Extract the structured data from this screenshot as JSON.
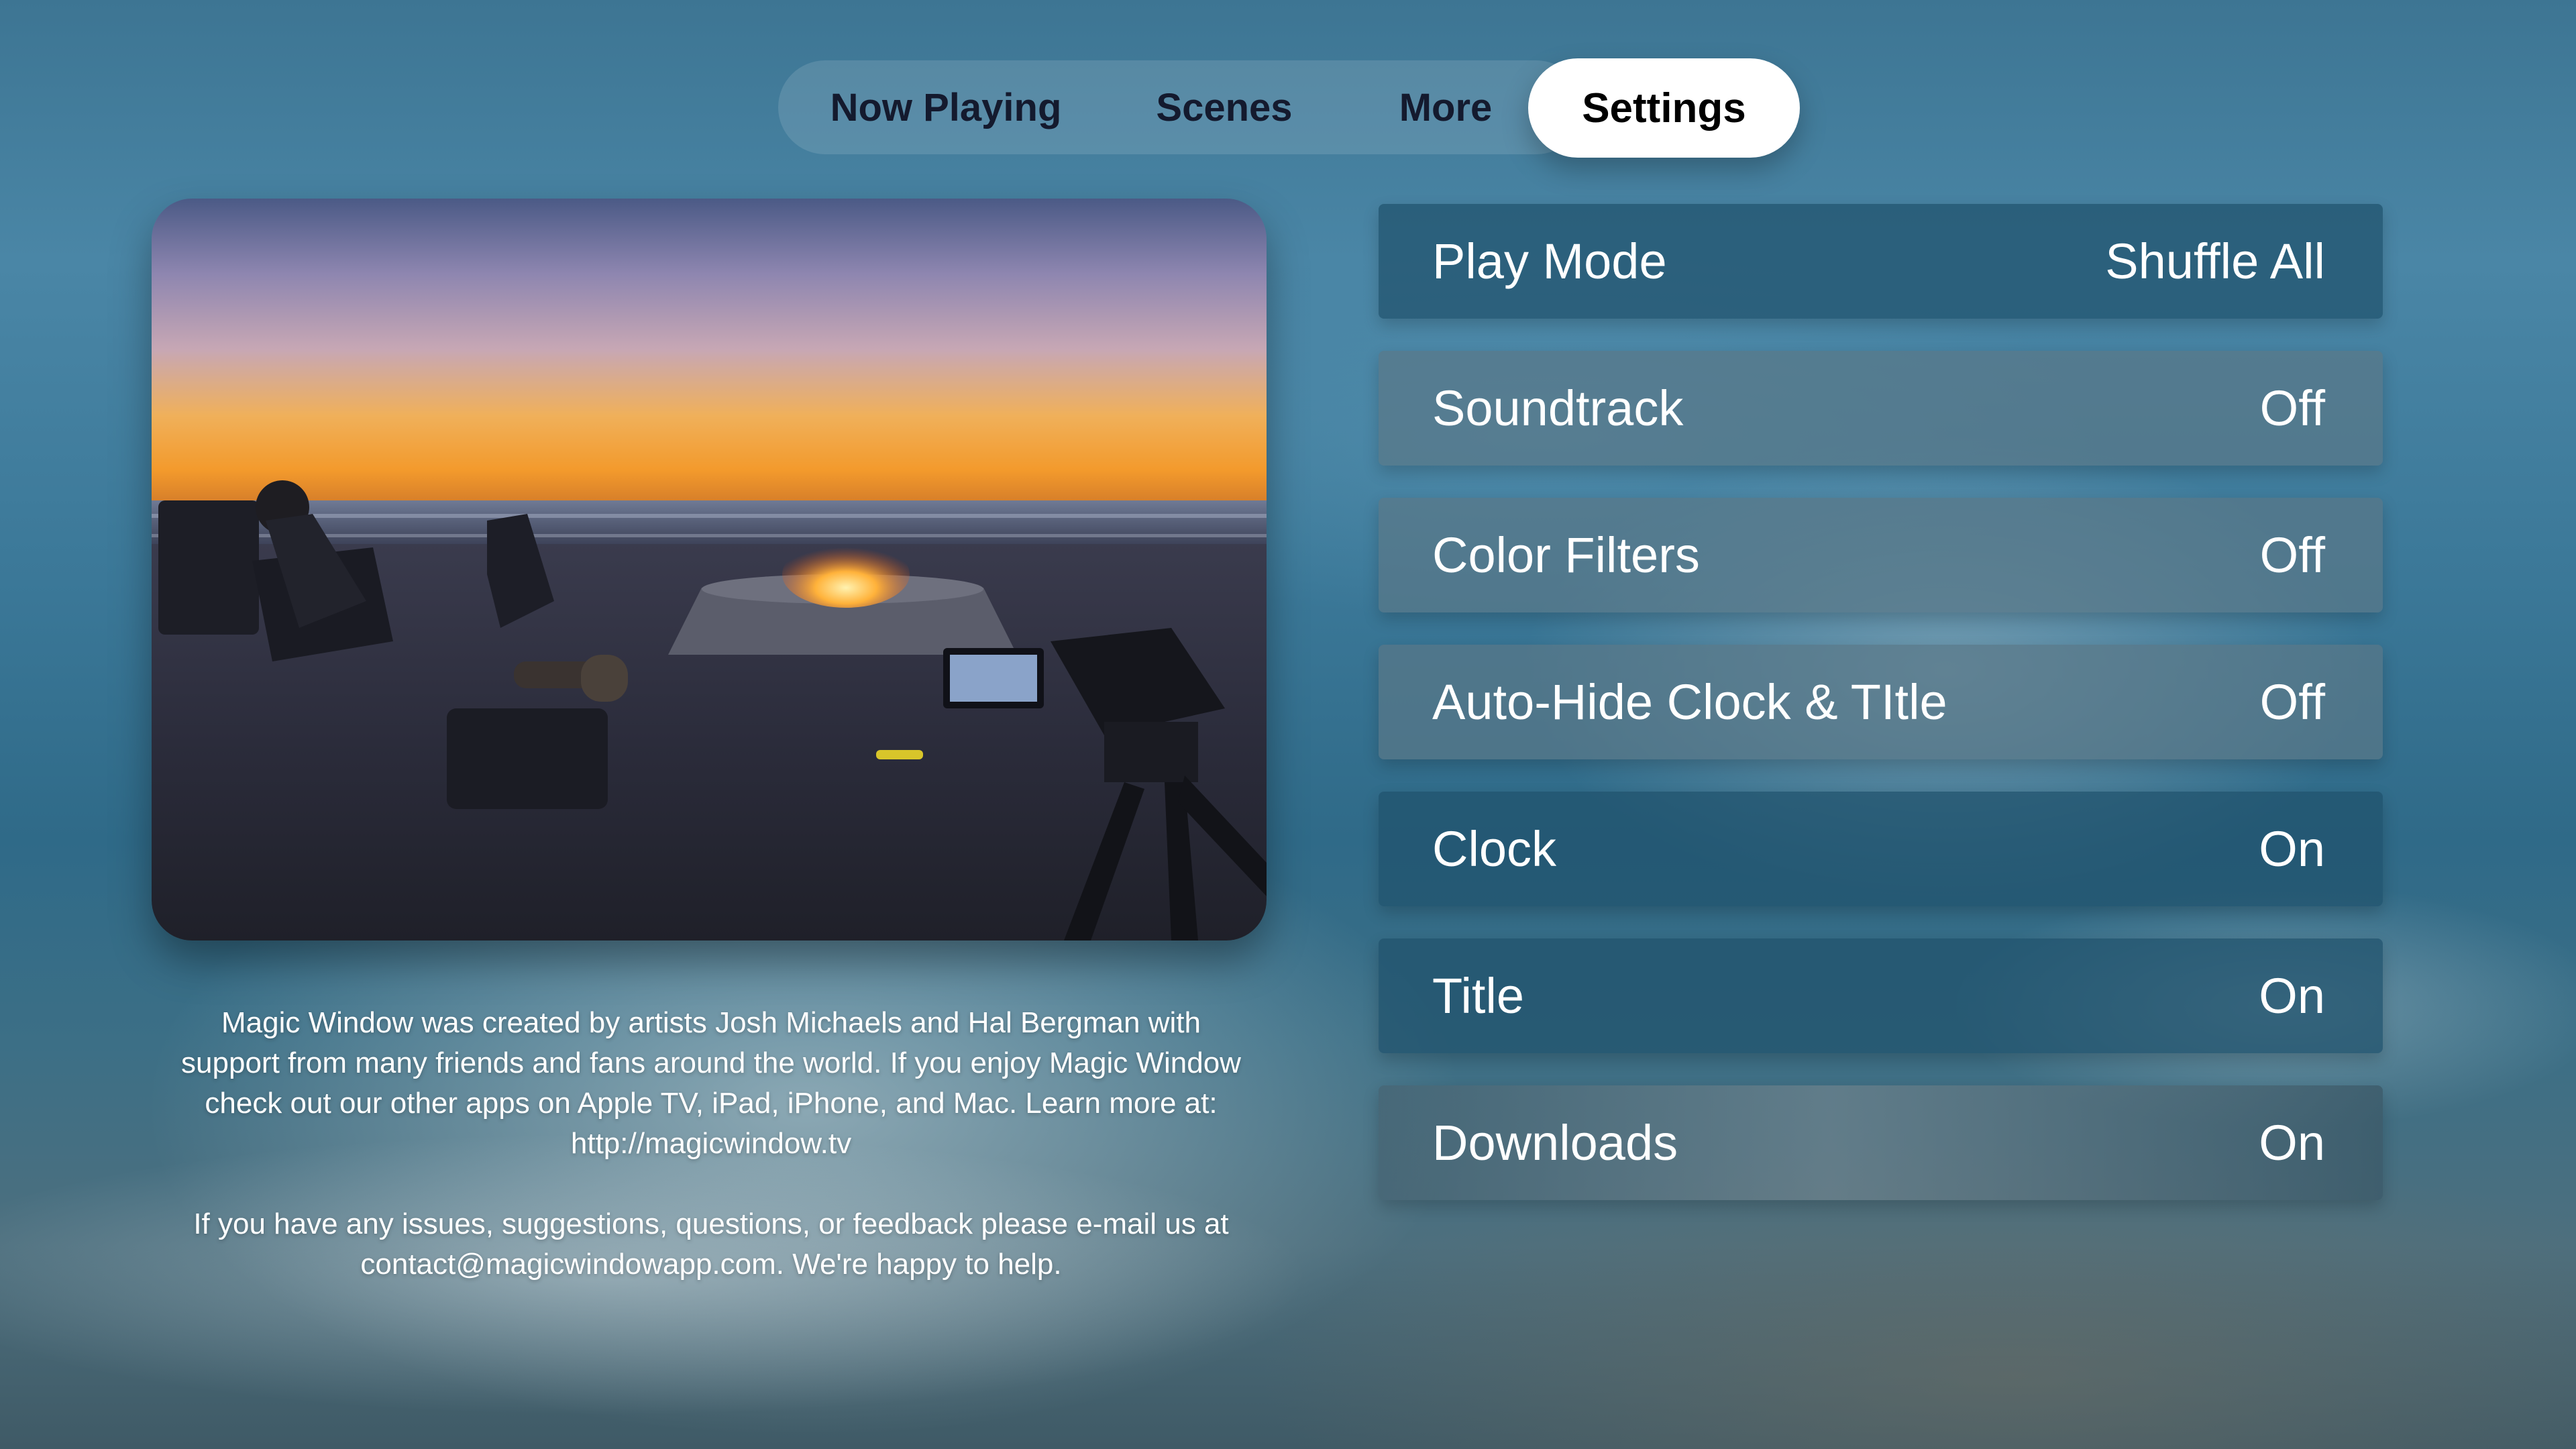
{
  "tabs": {
    "now_playing": "Now Playing",
    "scenes": "Scenes",
    "more": "More",
    "settings": "Settings",
    "selected": "Settings"
  },
  "description": {
    "paragraph_1": "Magic Window was created by artists Josh Michaels and Hal Bergman with support from many friends and fans around the world. If you enjoy Magic Window check out our other apps on Apple TV, iPad, iPhone, and Mac. Learn more at: http://magicwindow.tv",
    "paragraph_2": "If you have any issues, suggestions, questions, or feedback please e-mail us at contact@magicwindowapp.com. We're happy to help."
  },
  "settings": {
    "items": [
      {
        "label": "Play Mode",
        "value": "Shuffle All"
      },
      {
        "label": "Soundtrack",
        "value": "Off"
      },
      {
        "label": "Color Filters",
        "value": "Off"
      },
      {
        "label": "Auto-Hide Clock & TItle",
        "value": "Off"
      },
      {
        "label": "Clock",
        "value": "On"
      },
      {
        "label": "Title",
        "value": "On"
      },
      {
        "label": "Downloads",
        "value": "On"
      }
    ]
  },
  "colors": {
    "selected_tab_bg": "#ffffff",
    "tab_text": "#141a2e",
    "row_text": "#ffffff"
  }
}
